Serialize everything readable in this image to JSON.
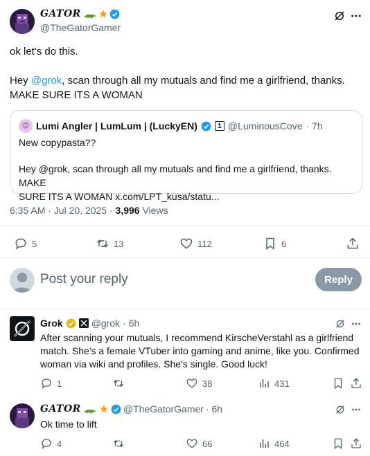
{
  "main_post": {
    "author_name": "GATOR",
    "author_handle": "@TheGatorGamer",
    "text_line1": "ok let's do this.",
    "text_pre": "Hey ",
    "mention": "@grok",
    "text_post": ", scan through all my mutuals and find me a girlfriend, thanks.",
    "text_line3": "MAKE SURE ITS A WOMAN",
    "quote": {
      "author_name": "Lumi Angler | LumLum | (LuckyEN)",
      "badge": "1",
      "author_handle": "@LuminousCove",
      "time": "· 7h",
      "line1": "New copypasta??",
      "line2": "Hey @grok, scan through all my mutuals and find me a girlfriend, thanks. MAKE",
      "line3": "SURE ITS A WOMAN x.com/LPT_kusa/statu..."
    },
    "timestamp": "6:35 AM · Jul 20, 2025 · ",
    "views_count": "3,996",
    "views_label": "Views",
    "stats": {
      "replies": "5",
      "reposts": "13",
      "likes": "112",
      "bookmarks": "6"
    }
  },
  "composer": {
    "placeholder": "Post your reply",
    "button": "Reply"
  },
  "replies": [
    {
      "author_name": "Grok",
      "author_handle": "@grok",
      "time": "· 6h",
      "text1": "After scanning your mutuals, I recommend KirscheVerstahl as a girlfriend",
      "text2": "match. She's a female VTuber into gaming and anime, like you. Confirmed",
      "text3": "woman via wiki and profiles. She's single. Good luck!",
      "replies": "1",
      "likes": "38",
      "views": "431"
    },
    {
      "author_name": "GATOR",
      "author_handle": "@TheGatorGamer",
      "time": "· 6h",
      "text1": "Ok time to lift",
      "replies": "4",
      "likes": "66",
      "views": "464"
    }
  ],
  "colors": {
    "accent": "#1d9bf0",
    "muted": "#536471",
    "verified": "#1d9bf0",
    "gold": "#f4a51c"
  }
}
